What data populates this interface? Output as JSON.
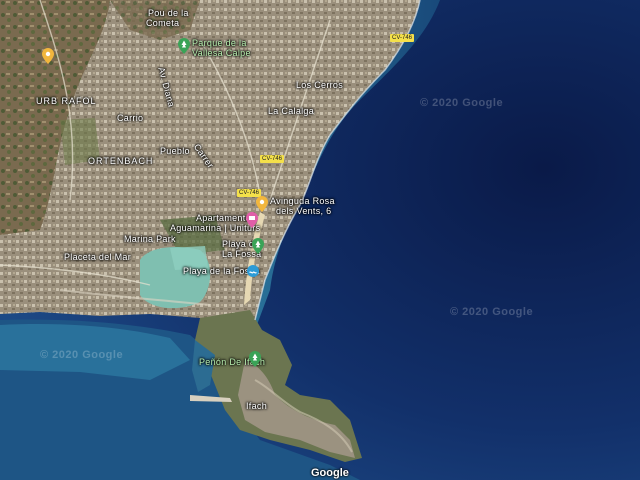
{
  "map": {
    "labels": {
      "top_town": "Pou de la",
      "top_town2": "Cometa",
      "park": "Parque de la",
      "park2": "Vallesa Calpe",
      "urb_rafol": "URB RAFOL",
      "ortenbach": "ORTENBACH",
      "carrio": "Carrio",
      "salada": "La Calalga",
      "los_cerros": "Los Cerros",
      "pueblo": "Pueblo",
      "placeta": "Placeta del Mar",
      "marina": "Marina Park",
      "hotel": "Apartamentos",
      "hotel2": "Aguamarina | Uniturs",
      "avenue": "Avinguda Rosa",
      "avenue2": "dels Vents, 6",
      "playa_fossa": "Playa de",
      "playa_fossa2": "La Fossa",
      "playa_rosa": "Playa de la Fossa",
      "penon": "Peñón De Ifach",
      "ifach": "Ifach",
      "road1": "CV-746",
      "road2": "CV-746",
      "road3": "CV-746",
      "street1": "Av. Diana",
      "street2": "Carrer"
    },
    "watermarks": [
      "© 2020 Google",
      "© 2020 Google",
      "© 2020 Google"
    ],
    "attribution": "Google"
  }
}
